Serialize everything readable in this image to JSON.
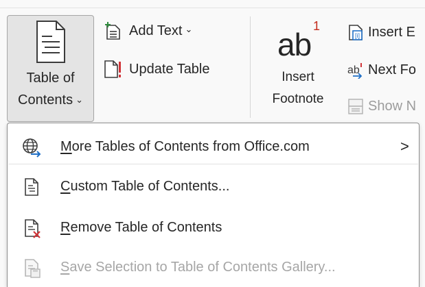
{
  "ribbon": {
    "toc_button": {
      "line1": "Table of",
      "line2": "Contents",
      "chevron": "⌄"
    },
    "add_text": {
      "label": "Add Text",
      "chevron": "⌄"
    },
    "update_table": {
      "label": "Update Table"
    },
    "insert_footnote": {
      "glyph": "ab",
      "superscript": "1",
      "line1": "Insert",
      "line2": "Footnote"
    },
    "insert_endnote": {
      "label": "Insert E"
    },
    "next_footnote": {
      "label": "Next Fo"
    },
    "show_notes": {
      "label": "Show N"
    }
  },
  "menu": {
    "items": [
      {
        "accel": "M",
        "rest": "ore Tables of Contents from Office.com",
        "icon": "globe-icon",
        "submenu_arrow": ">"
      },
      {
        "accel": "C",
        "rest": "ustom Table of Contents...",
        "icon": "document-icon"
      },
      {
        "accel": "R",
        "rest": "emove Table of Contents",
        "icon": "document-remove-icon"
      },
      {
        "accel": "S",
        "rest": "ave Selection to Table of Contents Gallery...",
        "icon": "save-to-gallery-icon",
        "disabled": true
      }
    ]
  },
  "colors": {
    "accent_blue": "#1f6fc6",
    "remove_red": "#d13438",
    "disabled_gray": "#a6a6a6"
  }
}
